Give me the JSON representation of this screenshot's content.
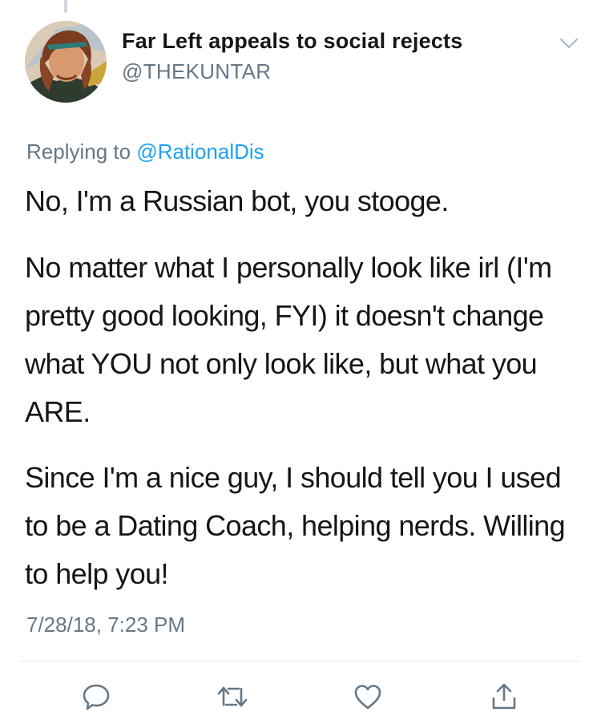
{
  "tweet": {
    "display_name": "Far Left appeals to social rejects",
    "handle": "@THEKUNTAR",
    "reply_prefix": "Replying to",
    "reply_to": "@RationalDis",
    "paragraphs": [
      "No, I'm a Russian bot, you stooge.",
      "No matter what I personally look like irl (I'm pretty good looking, FYI) it doesn't change what YOU not only look like, but what you ARE.",
      "Since I'm a nice guy, I should tell you I used to be a Dating Coach, helping nerds. Willing to help you!"
    ],
    "timestamp": "7/28/18, 7:23 PM"
  },
  "icons": {
    "menu": "chevron-down-icon",
    "reply": "reply-icon",
    "retweet": "retweet-icon",
    "like": "heart-icon",
    "share": "share-icon"
  },
  "colors": {
    "text": "#14171a",
    "secondary": "#657786",
    "link": "#1da1f2",
    "divider": "#e1e8ed",
    "icon": "#657786"
  }
}
